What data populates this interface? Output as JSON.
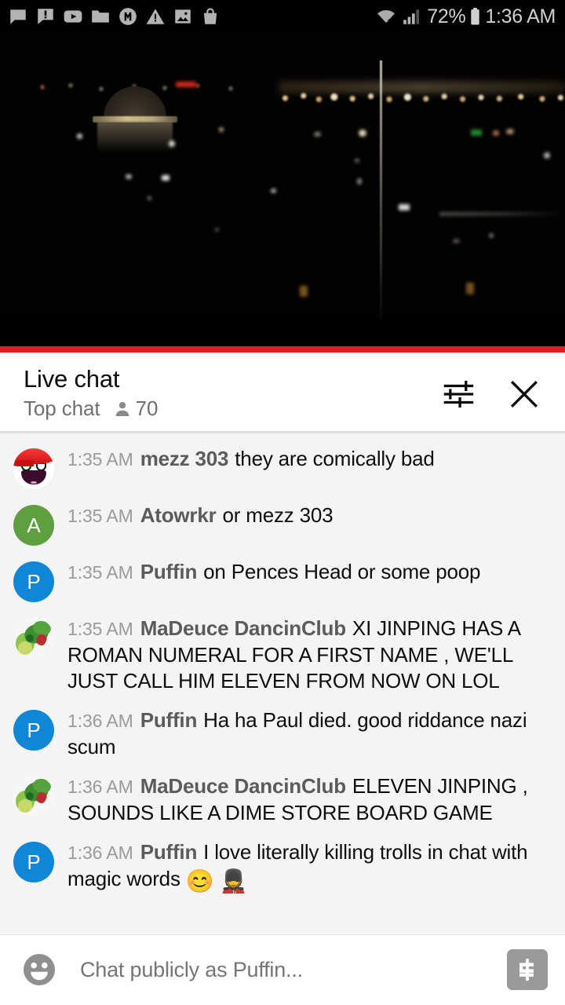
{
  "statusbar": {
    "icons": [
      "chat-bubble-icon",
      "chat-alert-icon",
      "youtube-icon",
      "folder-icon",
      "m-circle-icon",
      "warning-icon",
      "photo-icon",
      "bag-icon"
    ],
    "wifi_icon": "wifi-icon",
    "signal_icon": "cell-signal-icon",
    "battery_label": "72%",
    "battery_icon": "battery-icon",
    "clock": "1:36 AM"
  },
  "video": {
    "name": "live-video-player",
    "scene": "night cityscape with memorial dome and skyline lights",
    "progress_color": "#e02020"
  },
  "chat_header": {
    "title": "Live chat",
    "mode": "Top chat",
    "viewer_icon": "person-icon",
    "viewer_count": "70",
    "settings_icon": "tune-icon",
    "close_icon": "close-icon"
  },
  "messages": [
    {
      "time": "1:35 AM",
      "author": "mezz 303",
      "text": "they are comically bad",
      "avatar": {
        "type": "epic",
        "letter": "",
        "color": "#ffffff"
      }
    },
    {
      "time": "1:35 AM",
      "author": "Atowrkr",
      "text": "or mezz 303",
      "avatar": {
        "type": "letter",
        "letter": "A",
        "color": "#5e9f3f"
      }
    },
    {
      "time": "1:35 AM",
      "author": "Puffin",
      "text": "on Pences Head or some poop",
      "avatar": {
        "type": "letter",
        "letter": "P",
        "color": "#1186d6"
      }
    },
    {
      "time": "1:35 AM",
      "author": "MaDeuce DancinClub",
      "text": "XI JINPING HAS A ROMAN NUMERAL FOR A FIRST NAME , WE'LL JUST CALL HIM ELEVEN FROM NOW ON LOL",
      "avatar": {
        "type": "dragon",
        "letter": "",
        "color": "#5aa83c"
      }
    },
    {
      "time": "1:36 AM",
      "author": "Puffin",
      "text": "Ha ha Paul died. good riddance nazi scum",
      "avatar": {
        "type": "letter",
        "letter": "P",
        "color": "#1186d6"
      }
    },
    {
      "time": "1:36 AM",
      "author": "MaDeuce DancinClub",
      "text": "ELEVEN JINPING , SOUNDS LIKE A DIME STORE BOARD GAME",
      "avatar": {
        "type": "dragon",
        "letter": "",
        "color": "#5aa83c"
      }
    },
    {
      "time": "1:36 AM",
      "author": "Puffin",
      "text": "I love literally killing trolls in chat with magic words 😊 💂",
      "avatar": {
        "type": "letter",
        "letter": "P",
        "color": "#1186d6"
      }
    }
  ],
  "input_bar": {
    "emoji_icon": "emoji-face-icon",
    "placeholder": "Chat publicly as Puffin...",
    "value": "",
    "superchat_icon": "dollar-icon"
  }
}
